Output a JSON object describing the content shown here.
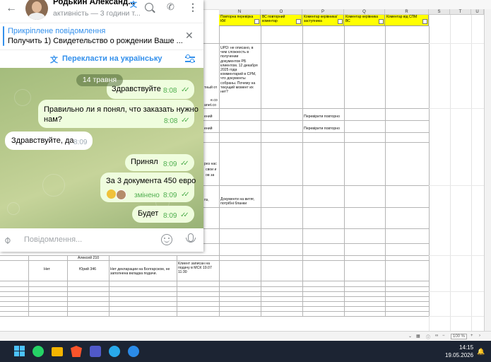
{
  "telegram": {
    "contact_name": "Родькин Александ...",
    "status": "активність — 3 години т...",
    "pinned_title": "Прикріплене повідомлення",
    "pinned_text": "Получить  1) Свидетельство о рождении Ваше ...",
    "translate_label": "Перекласти на українську",
    "date_chip": "14 травня",
    "input_placeholder": "Повідомлення...",
    "messages": [
      {
        "dir": "out",
        "text": "Здравствуйте",
        "time": "8:08",
        "read": true
      },
      {
        "dir": "out",
        "text": "Правильно ли я понял, что заказать нужно",
        "text2": "нам?",
        "time": "8:08",
        "read": true
      },
      {
        "dir": "in",
        "text": "Здравствуйте, да",
        "time": "8:09"
      },
      {
        "dir": "out",
        "text": "Принял",
        "time": "8:09",
        "read": true
      },
      {
        "dir": "out",
        "text": "За 3 документа 450 евро",
        "edited": "змінено",
        "time": "8:09",
        "read": true
      },
      {
        "dir": "out",
        "text": "Будет",
        "time": "8:09",
        "read": true
      }
    ]
  },
  "sheet": {
    "columns": [
      "N",
      "O",
      "P",
      "Q",
      "R",
      "S",
      "T",
      "U"
    ],
    "headers": [
      "Повторна перевірка КМ",
      "ВС повторний коментар",
      "Коментар керівника/заступника",
      "Коментар керівника ВС",
      "Коментар від СПМ"
    ],
    "upd_note": [
      "UPD: не описано, в",
      "чем сложность в",
      "получении",
      "документов РБ",
      "клиентом. 12 декабря",
      "2025 года",
      "комментарий в СРМ,",
      "что документы",
      "собраны. Почему на",
      "текущий момент их",
      "нет?"
    ],
    "left_snips": [
      "тный от",
      "e.co",
      "anet.co",
      "ений",
      "ений",
      "рез нас",
      "свои и",
      "ов за",
      "пз,"
    ],
    "recheck": [
      "Перевірити повторно",
      "Перевірити повторно"
    ],
    "docs_note": [
      "Документи на витяг,",
      "потрібні бланки"
    ],
    "bottom": {
      "manager_top": "Алексей 210",
      "status": "Нет",
      "manager": "Юрий 346",
      "comment": [
        "Нет декларации на Болгарском, не",
        "заполнена вкладка подачи."
      ],
      "client_note": [
        "Клиент записан на",
        "подачу в МСК 19.07",
        "11:30"
      ]
    },
    "zoom": "100 %"
  },
  "taskbar": {
    "time": "14:15",
    "date": "19.05.2026"
  }
}
